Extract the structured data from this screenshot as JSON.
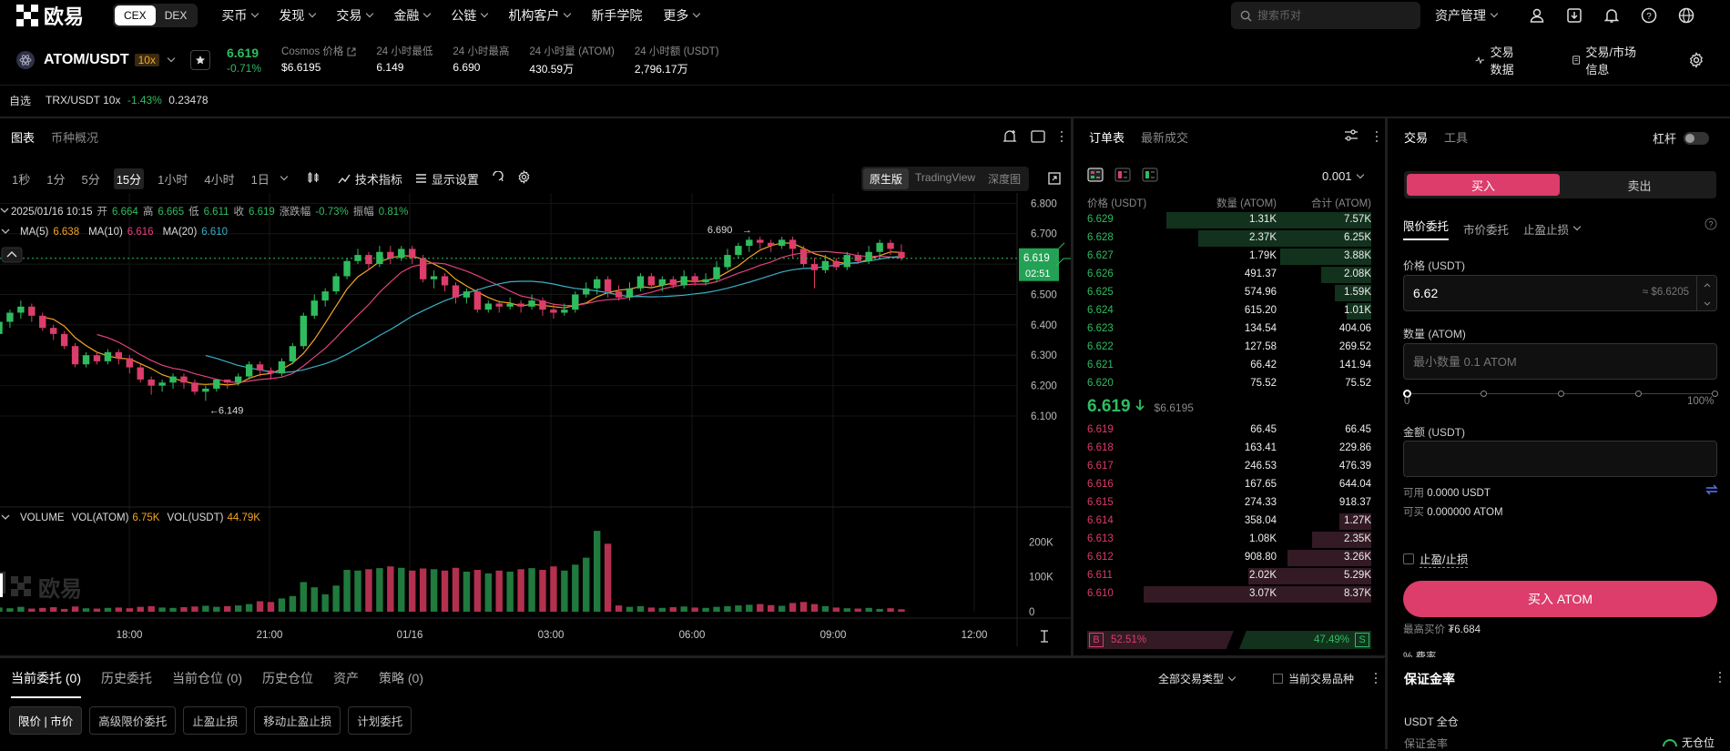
{
  "nav": {
    "logo_text": "欧易",
    "cex": "CEX",
    "dex": "DEX",
    "menu": [
      "买币",
      "发现",
      "交易",
      "金融",
      "公链",
      "机构客户",
      "新手学院",
      "更多"
    ],
    "menu_caret": [
      true,
      true,
      true,
      true,
      true,
      true,
      false,
      true
    ],
    "search_placeholder": "搜索币对",
    "asset_mgmt": "资产管理"
  },
  "ticker": {
    "pair": "ATOM/USDT",
    "leverage": "10x",
    "last_price": "6.619",
    "change_pct": "-0.71%",
    "stats": [
      {
        "label": "Cosmos 价格",
        "value": "$6.6195"
      },
      {
        "label": "24 小时最低",
        "value": "6.149"
      },
      {
        "label": "24 小时最高",
        "value": "6.690"
      },
      {
        "label": "24 小时量 (ATOM)",
        "value": "430.59万"
      },
      {
        "label": "24 小时额 (USDT)",
        "value": "2,796.17万"
      }
    ],
    "trade_data": "交易数据",
    "market_info": "交易/市场信息"
  },
  "watchlist": {
    "label": "自选",
    "item_pair": "TRX/USDT 10x",
    "item_change": "-1.43%",
    "item_price": "0.23478"
  },
  "chart_panel": {
    "tabs": [
      "图表",
      "币种概况"
    ],
    "intervals": [
      "1秒",
      "1分",
      "5分",
      "15分",
      "1小时",
      "4小时",
      "1日"
    ],
    "active_interval": "15分",
    "indicators": "技术指标",
    "display": "显示设置",
    "versions": [
      "原生版",
      "TradingView",
      "深度图"
    ]
  },
  "chart_data": {
    "type": "candlestick",
    "ohlc_info": {
      "date": "2025/01/16 10:15",
      "open_label": "开",
      "open": "6.664",
      "high_label": "高",
      "high": "6.665",
      "low_label": "低",
      "low": "6.611",
      "close_label": "收",
      "close": "6.619",
      "chg_label": "涨跌幅",
      "chg": "-0.73%",
      "amp_label": "振幅",
      "amp": "0.81%"
    },
    "ma_legend": [
      {
        "name": "MA(5)",
        "value": "6.638",
        "color": "#f5a623"
      },
      {
        "name": "MA(10)",
        "value": "6.616",
        "color": "#e0427f"
      },
      {
        "name": "MA(20)",
        "value": "6.610",
        "color": "#3ab0c6"
      }
    ],
    "price_ticks": [
      "6.800",
      "6.700",
      "6.600",
      "6.500",
      "6.400",
      "6.300",
      "6.200",
      "6.100"
    ],
    "price_tick_values": [
      6.8,
      6.7,
      6.6,
      6.5,
      6.4,
      6.3,
      6.2,
      6.1
    ],
    "price_range": [
      6.085,
      6.81
    ],
    "current_price_tag": "6.619",
    "countdown": "02:51",
    "high_marker": "6.690",
    "low_marker": "6.149",
    "x_ticks": [
      "18:00",
      "21:00",
      "01/16",
      "03:00",
      "06:00",
      "09:00",
      "12:00"
    ],
    "volume_legend": {
      "title": "VOLUME",
      "atom_label": "VOL(ATOM)",
      "atom": "6.75K",
      "usdt_label": "VOL(USDT)",
      "usdt": "44.79K"
    },
    "volume_ticks": [
      "200K",
      "100K",
      "0"
    ],
    "volume_tick_values": [
      200000,
      100000,
      0
    ],
    "volume_max": 235000,
    "watermark": "欧易",
    "candles": [
      [
        6.37,
        6.41,
        6.43,
        6.36
      ],
      [
        6.41,
        6.44,
        6.45,
        6.39
      ],
      [
        6.44,
        6.46,
        6.48,
        6.42
      ],
      [
        6.46,
        6.43,
        6.47,
        6.41
      ],
      [
        6.43,
        6.39,
        6.44,
        6.38
      ],
      [
        6.39,
        6.37,
        6.4,
        6.35
      ],
      [
        6.37,
        6.33,
        6.38,
        6.32
      ],
      [
        6.33,
        6.27,
        6.34,
        6.26
      ],
      [
        6.27,
        6.3,
        6.31,
        6.26
      ],
      [
        6.3,
        6.28,
        6.31,
        6.27
      ],
      [
        6.28,
        6.31,
        6.32,
        6.27
      ],
      [
        6.31,
        6.29,
        6.32,
        6.27
      ],
      [
        6.29,
        6.26,
        6.3,
        6.24
      ],
      [
        6.26,
        6.22,
        6.27,
        6.21
      ],
      [
        6.22,
        6.2,
        6.23,
        6.17
      ],
      [
        6.2,
        6.21,
        6.22,
        6.18
      ],
      [
        6.21,
        6.23,
        6.24,
        6.19
      ],
      [
        6.23,
        6.21,
        6.24,
        6.19
      ],
      [
        6.21,
        6.18,
        6.22,
        6.17
      ],
      [
        6.18,
        6.19,
        6.2,
        6.15
      ],
      [
        6.19,
        6.22,
        6.22,
        6.18
      ],
      [
        6.22,
        6.21,
        6.22,
        6.19
      ],
      [
        6.21,
        6.23,
        6.24,
        6.2
      ],
      [
        6.23,
        6.27,
        6.28,
        6.22
      ],
      [
        6.27,
        6.25,
        6.28,
        6.23
      ],
      [
        6.25,
        6.24,
        6.26,
        6.22
      ],
      [
        6.24,
        6.28,
        6.29,
        6.23
      ],
      [
        6.28,
        6.33,
        6.34,
        6.27
      ],
      [
        6.33,
        6.43,
        6.44,
        6.32
      ],
      [
        6.43,
        6.48,
        6.5,
        6.42
      ],
      [
        6.48,
        6.51,
        6.52,
        6.46
      ],
      [
        6.51,
        6.56,
        6.57,
        6.5
      ],
      [
        6.56,
        6.61,
        6.62,
        6.55
      ],
      [
        6.61,
        6.63,
        6.65,
        6.6
      ],
      [
        6.63,
        6.6,
        6.64,
        6.58
      ],
      [
        6.6,
        6.64,
        6.66,
        6.59
      ],
      [
        6.64,
        6.62,
        6.66,
        6.6
      ],
      [
        6.62,
        6.65,
        6.66,
        6.61
      ],
      [
        6.65,
        6.62,
        6.66,
        6.6
      ],
      [
        6.62,
        6.55,
        6.63,
        6.54
      ],
      [
        6.55,
        6.56,
        6.58,
        6.52
      ],
      [
        6.56,
        6.53,
        6.57,
        6.51
      ],
      [
        6.53,
        6.49,
        6.54,
        6.47
      ],
      [
        6.49,
        6.51,
        6.52,
        6.47
      ],
      [
        6.51,
        6.45,
        6.52,
        6.44
      ],
      [
        6.45,
        6.47,
        6.48,
        6.44
      ],
      [
        6.47,
        6.46,
        6.48,
        6.44
      ],
      [
        6.46,
        6.47,
        6.49,
        6.45
      ],
      [
        6.47,
        6.46,
        6.48,
        6.44
      ],
      [
        6.46,
        6.48,
        6.5,
        6.45
      ],
      [
        6.48,
        6.45,
        6.49,
        6.43
      ],
      [
        6.45,
        6.44,
        6.47,
        6.42
      ],
      [
        6.44,
        6.45,
        6.47,
        6.43
      ],
      [
        6.45,
        6.5,
        6.51,
        6.44
      ],
      [
        6.5,
        6.52,
        6.54,
        6.49
      ],
      [
        6.52,
        6.55,
        6.56,
        6.5
      ],
      [
        6.55,
        6.51,
        6.56,
        6.49
      ],
      [
        6.51,
        6.49,
        6.53,
        6.48
      ],
      [
        6.49,
        6.52,
        6.54,
        6.48
      ],
      [
        6.52,
        6.56,
        6.57,
        6.51
      ],
      [
        6.56,
        6.53,
        6.57,
        6.52
      ],
      [
        6.53,
        6.55,
        6.56,
        6.51
      ],
      [
        6.55,
        6.53,
        6.56,
        6.52
      ],
      [
        6.53,
        6.56,
        6.58,
        6.52
      ],
      [
        6.56,
        6.54,
        6.57,
        6.53
      ],
      [
        6.54,
        6.55,
        6.57,
        6.53
      ],
      [
        6.55,
        6.59,
        6.61,
        6.54
      ],
      [
        6.59,
        6.63,
        6.65,
        6.58
      ],
      [
        6.63,
        6.66,
        6.67,
        6.62
      ],
      [
        6.66,
        6.68,
        6.69,
        6.64
      ],
      [
        6.68,
        6.67,
        6.69,
        6.65
      ],
      [
        6.67,
        6.66,
        6.68,
        6.64
      ],
      [
        6.66,
        6.68,
        6.69,
        6.65
      ],
      [
        6.68,
        6.65,
        6.69,
        6.62
      ],
      [
        6.65,
        6.6,
        6.66,
        6.59
      ],
      [
        6.6,
        6.58,
        6.62,
        6.52
      ],
      [
        6.58,
        6.61,
        6.63,
        6.57
      ],
      [
        6.61,
        6.59,
        6.62,
        6.58
      ],
      [
        6.59,
        6.63,
        6.64,
        6.58
      ],
      [
        6.63,
        6.61,
        6.64,
        6.6
      ],
      [
        6.61,
        6.64,
        6.66,
        6.6
      ],
      [
        6.64,
        6.67,
        6.68,
        6.62
      ],
      [
        6.67,
        6.65,
        6.68,
        6.63
      ],
      [
        6.64,
        6.62,
        6.665,
        6.611
      ]
    ],
    "volumes": [
      12000,
      10000,
      14000,
      9000,
      11000,
      13000,
      8000,
      15000,
      10000,
      9000,
      11000,
      12000,
      10000,
      14000,
      16000,
      12000,
      11000,
      13000,
      15000,
      17000,
      14000,
      16000,
      18000,
      22000,
      30000,
      28000,
      38000,
      45000,
      85000,
      70000,
      50000,
      75000,
      120000,
      118000,
      122000,
      125000,
      130000,
      126000,
      118000,
      124000,
      122000,
      118000,
      126000,
      115000,
      120000,
      110000,
      118000,
      115000,
      122000,
      125000,
      120000,
      130000,
      118000,
      135000,
      155000,
      232000,
      195000,
      18000,
      14000,
      16000,
      12000,
      11000,
      13000,
      15000,
      12000,
      11000,
      14000,
      16000,
      18000,
      20000,
      22000,
      19000,
      17000,
      25000,
      28000,
      22000,
      16000,
      12000,
      10000,
      9000,
      11000,
      8000,
      10000,
      7000
    ]
  },
  "orderbook": {
    "tabs": [
      "订单表",
      "最新成交"
    ],
    "precision": "0.001",
    "col_price": "价格 (USDT)",
    "col_qty": "数量 (ATOM)",
    "col_total": "合计 (ATOM)",
    "bids": [
      {
        "price": "6.629",
        "qty": "1.31K",
        "total": "7.57K",
        "depth": 0.9
      },
      {
        "price": "6.628",
        "qty": "2.37K",
        "total": "6.25K",
        "depth": 0.76
      },
      {
        "price": "6.627",
        "qty": "1.79K",
        "total": "3.88K",
        "depth": 0.4
      },
      {
        "price": "6.626",
        "qty": "491.37",
        "total": "2.08K",
        "depth": 0.22
      },
      {
        "price": "6.625",
        "qty": "574.96",
        "total": "1.59K",
        "depth": 0.16
      },
      {
        "price": "6.624",
        "qty": "615.20",
        "total": "1.01K",
        "depth": 0.11
      },
      {
        "price": "6.623",
        "qty": "134.54",
        "total": "404.06",
        "depth": 0.0
      },
      {
        "price": "6.622",
        "qty": "127.58",
        "total": "269.52",
        "depth": 0.0
      },
      {
        "price": "6.621",
        "qty": "66.42",
        "total": "141.94",
        "depth": 0.0
      },
      {
        "price": "6.620",
        "qty": "75.52",
        "total": "75.52",
        "depth": 0.0
      }
    ],
    "mid_price": "6.619",
    "mid_usd": "$6.6195",
    "asks": [
      {
        "price": "6.619",
        "qty": "66.45",
        "total": "66.45",
        "depth": 0.0
      },
      {
        "price": "6.618",
        "qty": "163.41",
        "total": "229.86",
        "depth": 0.0
      },
      {
        "price": "6.617",
        "qty": "246.53",
        "total": "476.39",
        "depth": 0.0
      },
      {
        "price": "6.616",
        "qty": "167.65",
        "total": "644.04",
        "depth": 0.0
      },
      {
        "price": "6.615",
        "qty": "274.33",
        "total": "918.37",
        "depth": 0.0
      },
      {
        "price": "6.614",
        "qty": "358.04",
        "total": "1.27K",
        "depth": 0.14
      },
      {
        "price": "6.613",
        "qty": "1.08K",
        "total": "2.35K",
        "depth": 0.26
      },
      {
        "price": "6.612",
        "qty": "908.80",
        "total": "3.26K",
        "depth": 0.37
      },
      {
        "price": "6.611",
        "qty": "2.02K",
        "total": "5.29K",
        "depth": 0.54
      },
      {
        "price": "6.610",
        "qty": "3.07K",
        "total": "8.37K",
        "depth": 1.0
      }
    ],
    "buy_label": "B",
    "buy_pct": "52.51%",
    "buy_ratio": 0.5251,
    "sell_pct": "47.49%",
    "sell_label": "S"
  },
  "trade": {
    "tabs": [
      "交易",
      "工具"
    ],
    "leverage": "杠杆",
    "buy": "买入",
    "sell": "卖出",
    "order_types": [
      "限价委托",
      "市价委托",
      "止盈止损"
    ],
    "price_label": "价格 (USDT)",
    "price_value": "6.62",
    "price_usd": "≈ $6.6205",
    "qty_label": "数量 (ATOM)",
    "qty_placeholder": "最小数量 0.1 ATOM",
    "slider_min": "0",
    "slider_max": "100%",
    "amount_label": "金额 (USDT)",
    "avail_label": "可用",
    "avail_value": "0.0000 USDT",
    "buyable_label": "可买",
    "buyable_value": "0.000000 ATOM",
    "tpsl": "止盈/止损",
    "buy_btn": "买入 ATOM",
    "max_price_label": "最高买价",
    "max_price": "₮6.684",
    "fee_label": "费率"
  },
  "bottom": {
    "tabs": [
      "当前委托 (0)",
      "历史委托",
      "当前仓位 (0)",
      "历史仓位",
      "资产",
      "策略 (0)"
    ],
    "filter": "全部交易类型",
    "current_only": "当前交易品种",
    "subtabs": [
      "限价 | 市价",
      "高级限价委托",
      "止盈止损",
      "移动止盈止损",
      "计划委托"
    ]
  },
  "margin": {
    "title": "保证金率",
    "mode": "USDT 全仓",
    "ratio_label": "保证金率",
    "status": "无仓位"
  },
  "colors": {
    "up": "#2fbc5f",
    "down": "#dc3d6a",
    "accent": "#dc3d6a"
  }
}
